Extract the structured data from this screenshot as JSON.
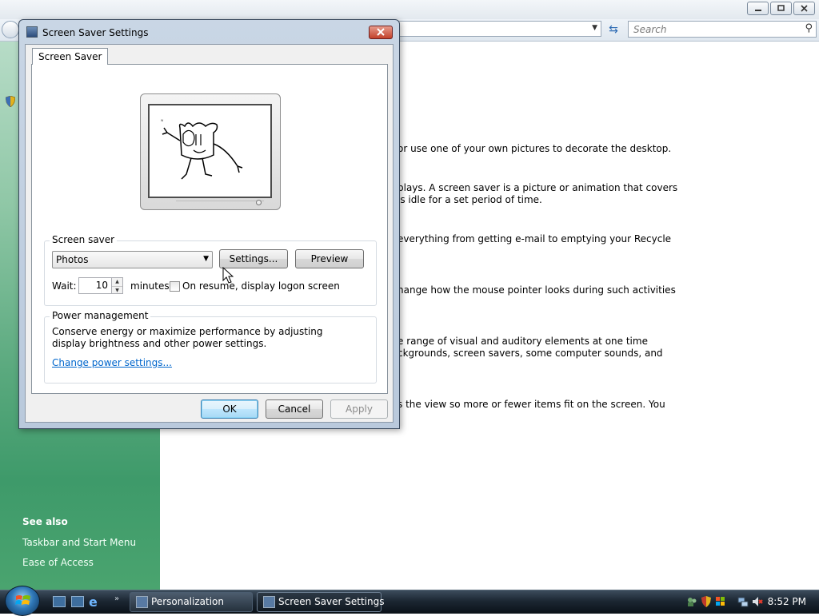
{
  "background_window": {
    "search_placeholder": "Search",
    "sidebar": {
      "see_also": "See also",
      "links": [
        "Taskbar and Start Menu",
        "Ease of Access"
      ]
    },
    "content_lines": [
      "or use one of your own pictures to decorate the desktop.",
      "plays. A screen saver is a picture or animation that covers",
      " is idle for a set period of time.",
      "everything from getting e-mail to emptying your Recycle",
      "hange how the mouse pointer looks during such activities",
      "e range of visual and auditory elements at one time",
      "ckgrounds, screen savers, some computer sounds, and",
      "s the view so more or fewer items fit on the screen. You"
    ]
  },
  "dialog": {
    "title": "Screen Saver Settings",
    "tab": "Screen Saver",
    "screen_saver_group": "Screen saver",
    "selected_screensaver": "Photos",
    "settings_button": "Settings...",
    "preview_button": "Preview",
    "wait_label": "Wait:",
    "wait_value": "10",
    "minutes_label": "minutes",
    "resume_label": "On resume, display logon screen",
    "resume_checked": false,
    "power_group": "Power management",
    "power_desc": "Conserve energy or maximize performance by adjusting display brightness and other power settings.",
    "power_link": "Change power settings...",
    "ok": "OK",
    "cancel": "Cancel",
    "apply": "Apply"
  },
  "taskbar": {
    "tasks": [
      "Personalization",
      "Screen Saver Settings"
    ],
    "clock": "8:52 PM"
  },
  "colors": {
    "link": "#0066cc",
    "sidebar_green": "#5aa97e",
    "close_red": "#c2412a"
  }
}
